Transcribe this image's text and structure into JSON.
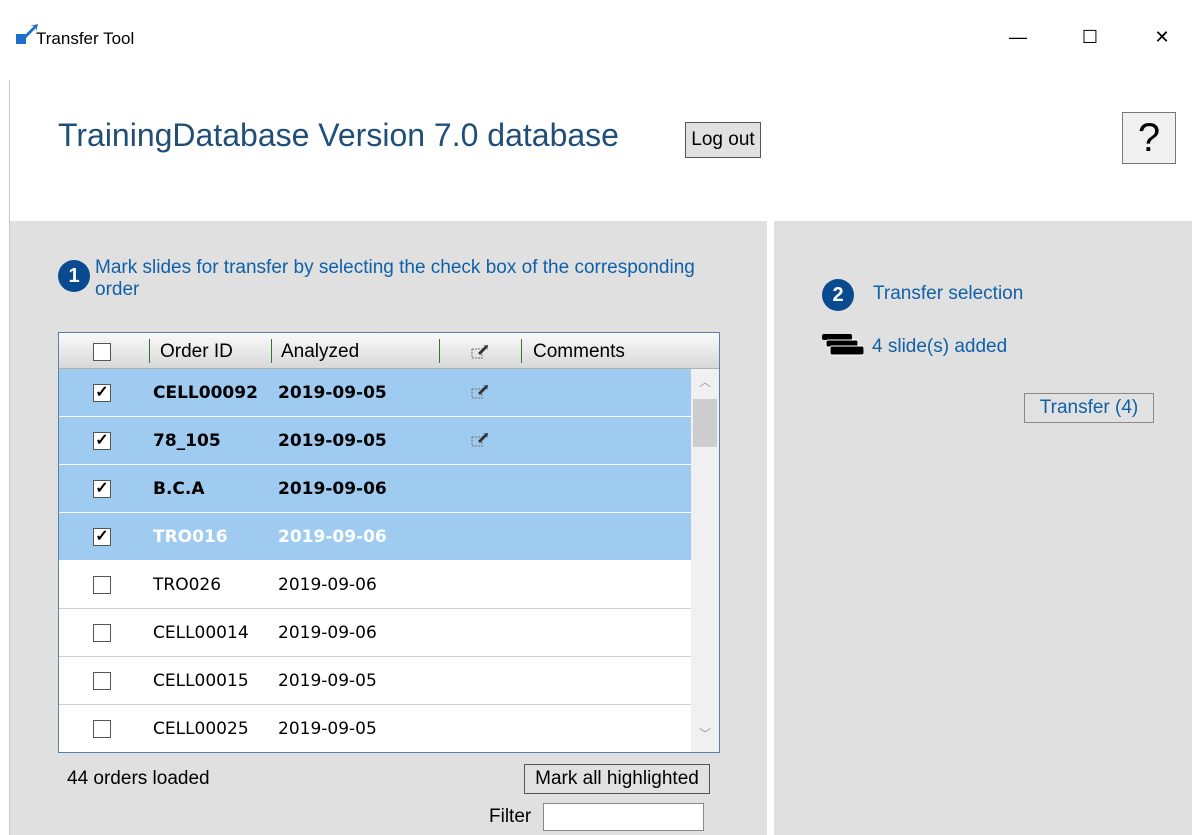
{
  "window": {
    "title": "Transfer Tool",
    "minimize": "—",
    "maximize": "☐",
    "close": "✕"
  },
  "header": {
    "db_title": "TrainingDatabase Version 7.0 database",
    "logout_label": "Log out",
    "help_label": "?"
  },
  "step1": {
    "number": "1",
    "text": "Mark slides for transfer by selecting the check box of the corresponding order"
  },
  "step2": {
    "number": "2",
    "text": "Transfer selection",
    "slides_added": "4 slide(s) added",
    "transfer_label": "Transfer (4)"
  },
  "grid": {
    "columns": [
      "Order ID",
      "Analyzed",
      "Comments"
    ],
    "rows": [
      {
        "checked": true,
        "order_id": "CELL00092",
        "analyzed": "2019-09-05",
        "icon": true
      },
      {
        "checked": true,
        "order_id": "78_105",
        "analyzed": "2019-09-05",
        "icon": true
      },
      {
        "checked": true,
        "order_id": "B.C.A",
        "analyzed": "2019-09-06",
        "icon": false
      },
      {
        "checked": true,
        "order_id": "TRO016",
        "analyzed": "2019-09-06",
        "icon": false
      },
      {
        "checked": false,
        "order_id": "TRO026",
        "analyzed": "2019-09-06",
        "icon": false
      },
      {
        "checked": false,
        "order_id": "CELL00014",
        "analyzed": "2019-09-06",
        "icon": false
      },
      {
        "checked": false,
        "order_id": "CELL00015",
        "analyzed": "2019-09-05",
        "icon": false
      },
      {
        "checked": false,
        "order_id": "CELL00025",
        "analyzed": "2019-09-05",
        "icon": false
      }
    ]
  },
  "footer": {
    "orders_loaded": "44 orders loaded",
    "mark_all_label": "Mark all highlighted",
    "filter_label": "Filter",
    "filter_value": ""
  },
  "colors": {
    "selected_row": "#9fcbf0",
    "accent": "#1060a8",
    "step_badge": "#0a4a8f",
    "pane_bg": "#e0e0e0"
  }
}
